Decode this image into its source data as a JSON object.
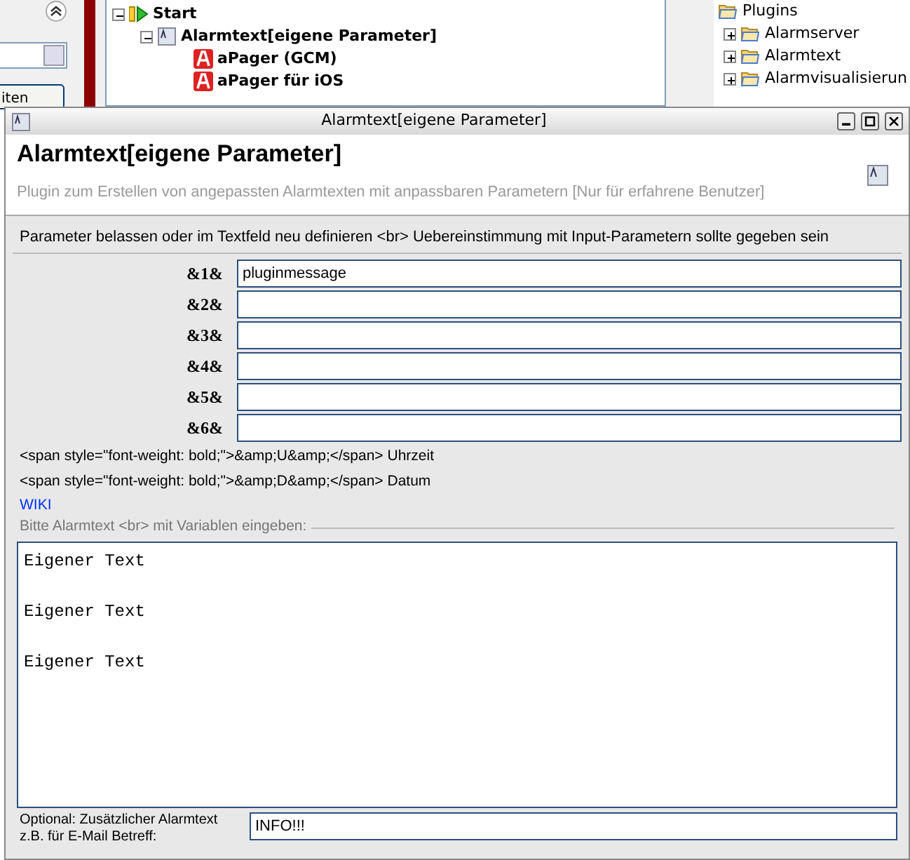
{
  "left_panel": {
    "button_label": "iten"
  },
  "flow_tree": [
    {
      "label": "Start",
      "kind": "start",
      "expanded": true,
      "children": [
        {
          "label": "Alarmtext[eigene Parameter]",
          "kind": "plugin",
          "expanded": true,
          "children": [
            {
              "label": "aPager (GCM)",
              "kind": "apager"
            },
            {
              "label": "aPager für iOS",
              "kind": "apager"
            }
          ]
        }
      ]
    }
  ],
  "plugin_tree": {
    "root": "Plugins",
    "items": [
      {
        "label": "Alarmserver",
        "expanded": false
      },
      {
        "label": "Alarmtext",
        "expanded": false
      },
      {
        "label": "Alarmvisualisierun",
        "expanded": false
      }
    ]
  },
  "dialog": {
    "title": "Alarmtext[eigene Parameter]",
    "heading": "Alarmtext[eigene Parameter]",
    "description": "Plugin zum Erstellen von angepassten Alarmtexten mit anpassbaren Parametern [Nur für erfahrene Benutzer]",
    "instruction": "Parameter belassen oder im Textfeld neu definieren <br> Uebereinstimmung mit Input-Parametern sollte gegeben sein",
    "params": [
      {
        "label": "&1&",
        "value": "pluginmessage"
      },
      {
        "label": "&2&"
      },
      {
        "label": "&3&"
      },
      {
        "label": "&4&"
      },
      {
        "label": "&5&"
      },
      {
        "label": "&6&"
      }
    ],
    "notes": [
      "<span style=\"font-weight: bold;\">&amp;U&amp;</span> Uhrzeit",
      "<span style=\"font-weight: bold;\">&amp;D&amp;</span> Datum"
    ],
    "link": "WIKI",
    "message_legend": "Bitte Alarmtext <br> mit Variablen eingeben:",
    "message": "Eigener Text\n\nEigener Text\n\nEigener Text",
    "optional_label": "Optional: Zusätzlicher Alarmtext z.B. für E-Mail Betreff:",
    "optional_value": "INFO!!!"
  }
}
